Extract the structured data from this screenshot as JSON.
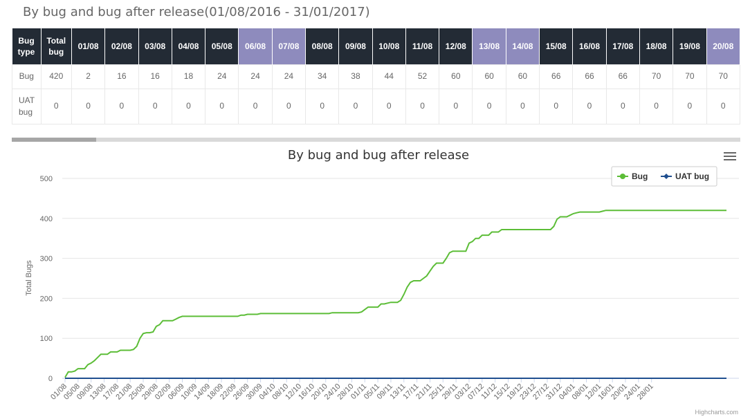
{
  "page": {
    "title": "By bug and bug after release(01/08/2016 - 31/01/2017)"
  },
  "colors": {
    "header_dark": "#232b35",
    "header_lavender": "#8e8bbd",
    "bug": "#5cbd37",
    "uat_bug": "#1f4e8f"
  },
  "table": {
    "headers": [
      "Bug type",
      "Total bug",
      "01/08",
      "02/08",
      "03/08",
      "04/08",
      "05/08",
      "06/08",
      "07/08",
      "08/08",
      "09/08",
      "10/08",
      "11/08",
      "12/08",
      "13/08",
      "14/08",
      "15/08",
      "16/08",
      "17/08",
      "18/08",
      "19/08",
      "20/08"
    ],
    "highlighted": [
      "06/08",
      "07/08",
      "13/08",
      "14/08",
      "20/08"
    ],
    "rows": [
      {
        "name": "Bug",
        "cells": [
          "Bug",
          "420",
          "2",
          "16",
          "16",
          "18",
          "24",
          "24",
          "24",
          "34",
          "38",
          "44",
          "52",
          "60",
          "60",
          "60",
          "66",
          "66",
          "66",
          "70",
          "70",
          "70"
        ]
      },
      {
        "name": "UAT bug",
        "cells": [
          "UAT bug",
          "0",
          "0",
          "0",
          "0",
          "0",
          "0",
          "0",
          "0",
          "0",
          "0",
          "0",
          "0",
          "0",
          "0",
          "0",
          "0",
          "0",
          "0",
          "0",
          "0",
          "0"
        ]
      }
    ]
  },
  "chart_data": {
    "type": "line",
    "title": "By bug and bug after release",
    "ylabel": "Total Bugs",
    "xlabel": "",
    "ylim": [
      0,
      500
    ],
    "yticks": [
      0,
      100,
      200,
      300,
      400,
      500
    ],
    "grid": true,
    "legend_position": "top-right",
    "x_tick_labels": [
      "01/08",
      "05/08",
      "09/08",
      "13/08",
      "17/08",
      "21/08",
      "25/08",
      "29/08",
      "02/09",
      "06/09",
      "10/09",
      "14/09",
      "18/09",
      "22/09",
      "26/09",
      "30/09",
      "04/10",
      "08/10",
      "12/10",
      "16/10",
      "20/10",
      "24/10",
      "28/10",
      "01/11",
      "05/11",
      "09/11",
      "13/11",
      "17/11",
      "21/11",
      "25/11",
      "29/11",
      "03/12",
      "07/12",
      "11/12",
      "15/12",
      "19/12",
      "23/12",
      "27/12",
      "31/12",
      "04/01",
      "08/01",
      "12/01",
      "16/01",
      "20/01",
      "24/01",
      "28/01"
    ],
    "series": [
      {
        "name": "Bug",
        "color": "#5cbd37",
        "values": [
          2,
          16,
          16,
          18,
          24,
          24,
          24,
          34,
          38,
          44,
          52,
          60,
          60,
          60,
          66,
          66,
          66,
          70,
          70,
          70,
          70,
          72,
          80,
          100,
          112,
          114,
          114,
          116,
          130,
          134,
          144,
          144,
          144,
          144,
          148,
          152,
          155,
          155,
          155,
          155,
          155,
          155,
          155,
          155,
          155,
          155,
          155,
          155,
          155,
          155,
          155,
          155,
          155,
          155,
          158,
          158,
          160,
          160,
          160,
          160,
          162,
          162,
          162,
          162,
          162,
          162,
          162,
          162,
          162,
          162,
          162,
          162,
          162,
          162,
          162,
          162,
          162,
          162,
          162,
          162,
          162,
          162,
          164,
          164,
          164,
          164,
          164,
          164,
          164,
          164,
          164,
          166,
          172,
          178,
          178,
          178,
          178,
          186,
          186,
          188,
          190,
          190,
          190,
          195,
          210,
          228,
          240,
          244,
          244,
          244,
          250,
          256,
          268,
          280,
          288,
          288,
          288,
          300,
          314,
          318,
          318,
          318,
          318,
          318,
          338,
          342,
          350,
          350,
          358,
          358,
          358,
          366,
          366,
          366,
          372,
          372,
          372,
          372,
          372,
          372,
          372,
          372,
          372,
          372,
          372,
          372,
          372,
          372,
          372,
          372,
          380,
          398,
          404,
          404,
          404,
          408,
          412,
          414,
          416,
          416,
          416,
          416,
          416,
          416,
          416,
          418,
          420,
          420,
          420,
          420,
          420,
          420,
          420,
          420,
          420,
          420,
          420,
          420,
          420,
          420,
          420,
          420,
          420,
          420,
          420,
          420,
          420,
          420,
          420,
          420,
          420,
          420,
          420,
          420,
          420,
          420,
          420,
          420,
          420,
          420,
          420,
          420,
          420,
          420
        ]
      },
      {
        "name": "UAT bug",
        "color": "#1f4e8f",
        "values": "zeros"
      }
    ]
  },
  "credits": "Highcharts.com"
}
